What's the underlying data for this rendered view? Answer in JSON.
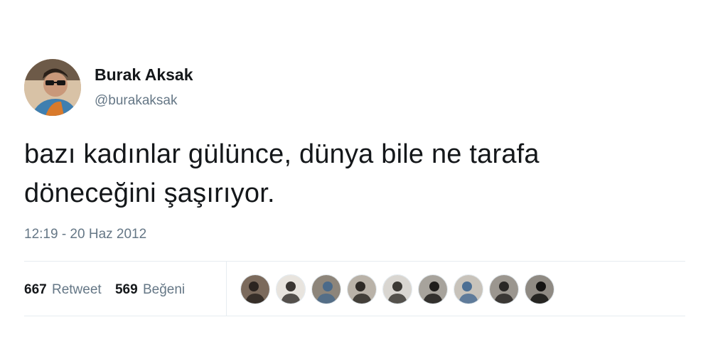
{
  "user": {
    "display_name": "Burak Aksak",
    "handle": "@burakaksak"
  },
  "tweet": {
    "text_line_1": "bazı kadınlar gülünce, dünya bile ne tarafa",
    "text_line_2": "döneceğini şaşırıyor.",
    "timestamp": "12:19 - 20 Haz 2012"
  },
  "stats": {
    "retweet_count": "667",
    "retweet_label": "Retweet",
    "like_count": "569",
    "like_label": "Beğeni"
  },
  "likers": [
    {
      "icon": "avatar-photo",
      "bg": "#7b6a5c",
      "fg": "#2b2420"
    },
    {
      "icon": "avatar-photo",
      "bg": "#e8e4de",
      "fg": "#3a3632"
    },
    {
      "icon": "avatar-photo",
      "bg": "#8d857a",
      "fg": "#4a6a8a"
    },
    {
      "icon": "avatar-photo",
      "bg": "#b9b2a8",
      "fg": "#2e2a26"
    },
    {
      "icon": "avatar-photo",
      "bg": "#d9d6d1",
      "fg": "#3c3935"
    },
    {
      "icon": "avatar-photo",
      "bg": "#a7a39c",
      "fg": "#1f1d1b"
    },
    {
      "icon": "avatar-photo",
      "bg": "#c8c3bb",
      "fg": "#4c6f94"
    },
    {
      "icon": "avatar-photo",
      "bg": "#9b968f",
      "fg": "#2a2826"
    },
    {
      "icon": "avatar-photo",
      "bg": "#8f8a83",
      "fg": "#141312"
    }
  ],
  "colors": {
    "text_primary": "#14171a",
    "text_secondary": "#657786",
    "divider": "#e6ecf0"
  }
}
